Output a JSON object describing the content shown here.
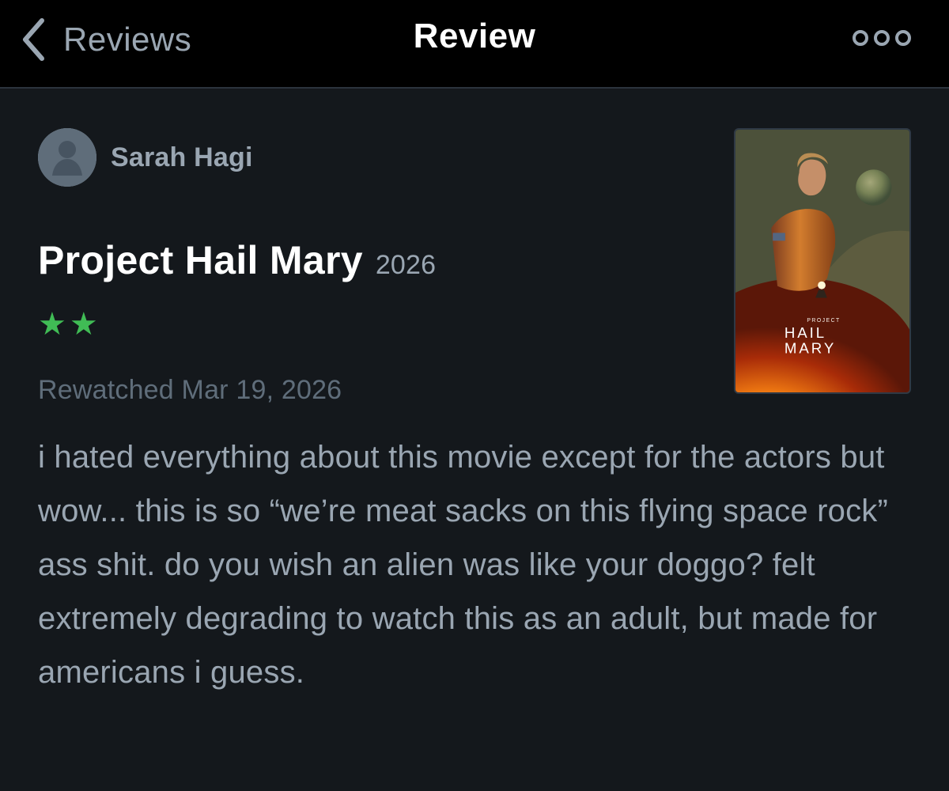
{
  "nav": {
    "back_label": "Reviews",
    "title": "Review"
  },
  "review": {
    "author": "Sarah Hagi",
    "film_title": "Project Hail Mary",
    "film_year": "2026",
    "rating_stars": 2,
    "rating_display": "★★",
    "rewatch_date": "Rewatched Mar 19, 2026",
    "text": "i hated everything about this movie except for the actors but wow... this is so “we’re meat sacks on this flying space rock” ass shit. do you wish an alien was like your doggo? felt extremely degrading to watch this as an adult, but made for americans i guess."
  },
  "poster": {
    "subtitle": "PROJECT",
    "title_line_1": "HAIL",
    "title_line_2": "MARY"
  },
  "colors": {
    "background": "#14181c",
    "navbar": "#000000",
    "muted_text": "#9aa6b2",
    "secondary_text": "#5f6d7a",
    "rating_green": "#40bc55",
    "white": "#ffffff"
  },
  "icons": {
    "back": "chevron-left-icon",
    "more": "ellipsis-icon",
    "avatar": "user-avatar-icon"
  }
}
